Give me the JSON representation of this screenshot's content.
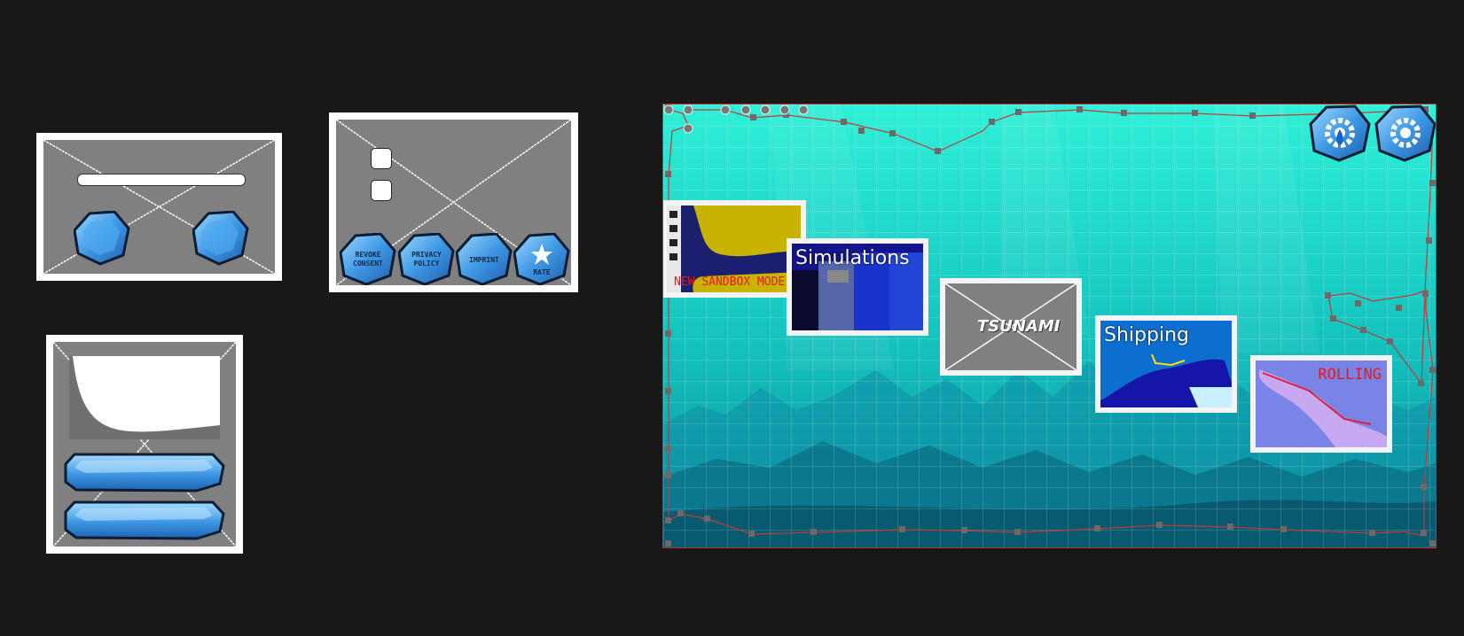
{
  "panel_consent": {
    "buttons": [
      {
        "label_line1": "REVOKE",
        "label_line2": "CONSENT"
      },
      {
        "label_line1": "PRIVACY",
        "label_line2": "POLICY"
      },
      {
        "label_line1": "IMPRINT",
        "label_line2": ""
      },
      {
        "label_line1": "RATE",
        "label_line2": ""
      }
    ]
  },
  "scene": {
    "cards": [
      {
        "title": "NEW SANDBOX MODE"
      },
      {
        "title": "Simulations"
      },
      {
        "title": "TSUNAMI"
      },
      {
        "title": "Shipping"
      },
      {
        "title": "ROLLING"
      }
    ],
    "top_icons": [
      "gear-water-icon",
      "gear-icon"
    ]
  },
  "colors": {
    "background": "#181818",
    "panel_gray": "#808080",
    "gem_blue": "#4aa3e8",
    "scene_teal": "#1fd9c8"
  }
}
